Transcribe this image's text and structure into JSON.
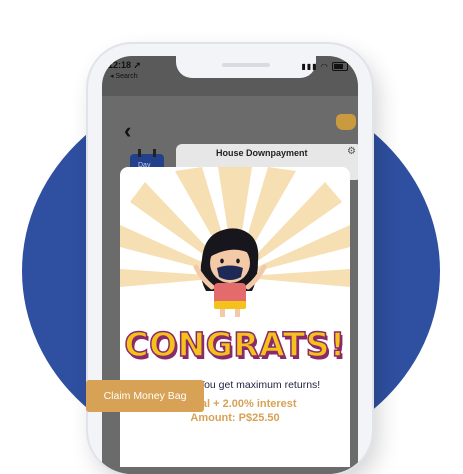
{
  "status_bar": {
    "time": "12:18 ➚",
    "back_label": "◂ Search",
    "icons": [
      "signal-icon",
      "wifi-icon",
      "battery-icon"
    ]
  },
  "screen": {
    "back_icon": "chevron-left-icon",
    "goal_title": "House Downpayment",
    "tab_label": "Day",
    "settings_icon": "gear-icon",
    "money_bag_icon": "money-bag-icon"
  },
  "modal": {
    "headline": "CONGRATS!",
    "message": "Congrats! You get maximum returns!",
    "interest_line": "Capital + 2.00% interest",
    "amount_line": "Amount: P$25.50",
    "button_label": "Claim Money Bag"
  },
  "colors": {
    "background_circle": "#2f4fa0",
    "accent": "#d7a256",
    "headline_fill": "#f4c21b",
    "headline_outline": "#8a2a6a",
    "message_text": "#1e2240"
  }
}
